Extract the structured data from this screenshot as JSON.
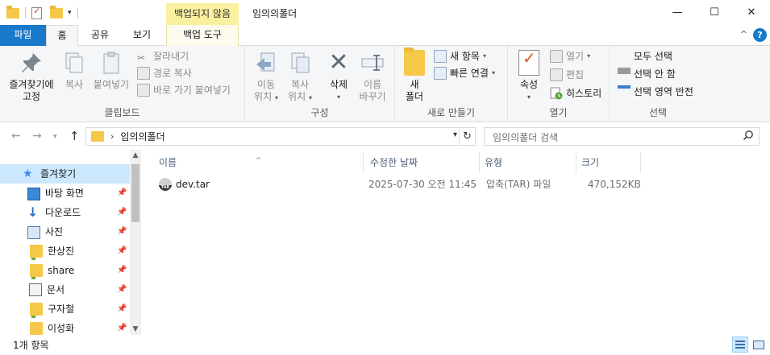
{
  "window": {
    "title": "임의의폴더",
    "context_tab_header": "백업되지 않음",
    "minimize": "—",
    "maximize": "☐",
    "close": "✕"
  },
  "tabs": {
    "file": "파일",
    "home": "홈",
    "share": "공유",
    "view": "보기",
    "tools": "백업 도구",
    "collapse_icon": "^",
    "help": "?"
  },
  "ribbon": {
    "clipboard": {
      "label": "클립보드",
      "pin_line1": "즐겨찾기에",
      "pin_line2": "고정",
      "copy": "복사",
      "paste": "붙여넣기",
      "cut": "잘라내기",
      "copy_path": "경로 복사",
      "paste_shortcut": "바로 가기 붙여넣기"
    },
    "organize": {
      "label": "구성",
      "move_line1": "이동",
      "move_line2": "위치",
      "copy_line1": "복사",
      "copy_line2": "위치",
      "delete": "삭제",
      "rename_line1": "이름",
      "rename_line2": "바꾸기"
    },
    "new": {
      "label": "새로 만들기",
      "new_folder_line1": "새",
      "new_folder_line2": "폴더",
      "new_item": "새 항목",
      "easy_access": "빠른 연결"
    },
    "open": {
      "label": "열기",
      "properties": "속성",
      "open": "열기",
      "edit": "편집",
      "history": "히스토리"
    },
    "select": {
      "label": "선택",
      "select_all": "모두 선택",
      "select_none": "선택 안 함",
      "invert": "선택 영역 반전"
    }
  },
  "address": {
    "breadcrumb": "임의의폴더",
    "search_placeholder": "임의의폴더 검색"
  },
  "navpane": {
    "items": [
      {
        "label": "즐겨찾기",
        "icon": "star-icon"
      },
      {
        "label": "바탕 화면",
        "icon": "desktop-icon"
      },
      {
        "label": "다운로드",
        "icon": "download-icon"
      },
      {
        "label": "사진",
        "icon": "pictures-icon"
      },
      {
        "label": "한상진",
        "icon": "folder-icon"
      },
      {
        "label": "share",
        "icon": "folder-icon"
      },
      {
        "label": "문서",
        "icon": "documents-icon"
      },
      {
        "label": "구자철",
        "icon": "folder-icon"
      },
      {
        "label": "이성화",
        "icon": "folder-icon"
      }
    ]
  },
  "filelist": {
    "columns": {
      "name": "이름",
      "modified": "수정한 날짜",
      "type": "유형",
      "size": "크기"
    },
    "rows": [
      {
        "name": "dev.tar",
        "modified": "2025-07-30 오전 11:45",
        "type": "압축(TAR) 파일",
        "size": "470,152KB"
      }
    ]
  },
  "status": {
    "count": "1개 항목"
  }
}
